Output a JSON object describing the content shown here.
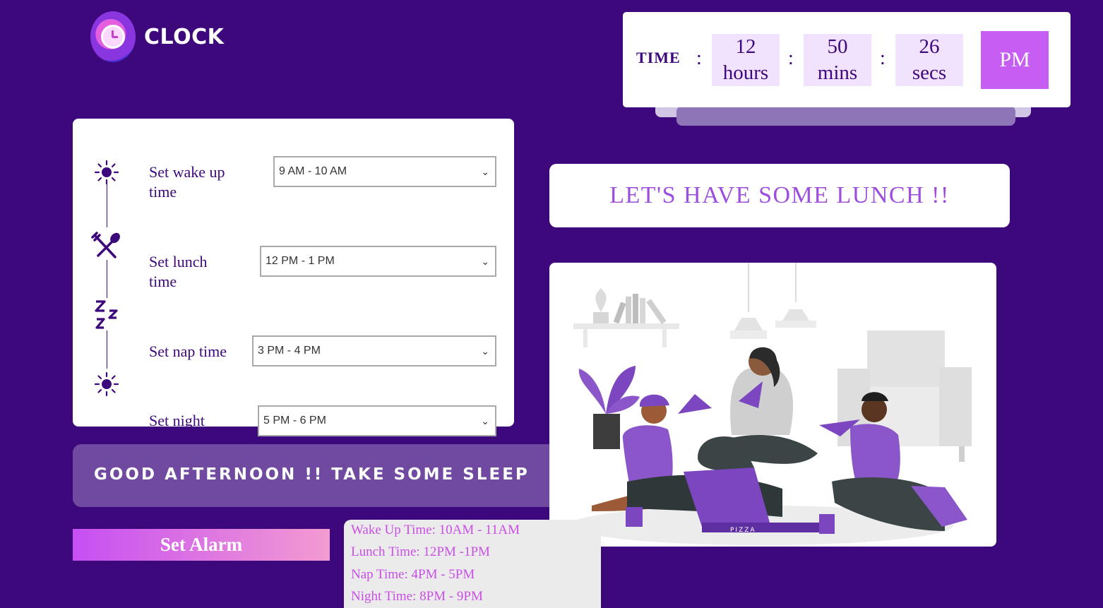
{
  "logo": {
    "text": "CLOCK",
    "icon": "clock-icon"
  },
  "time": {
    "label": "TIME",
    "hours_value": "12",
    "hours_unit": "hours",
    "mins_value": "50",
    "mins_unit": "mins",
    "secs_value": "26",
    "secs_unit": "secs",
    "separator": ":",
    "ampm": "PM"
  },
  "settings": {
    "rows": [
      {
        "icon": "sun-icon",
        "label_line1": "Set wake up",
        "label_line2": "time",
        "selected": "9 AM - 10 AM"
      },
      {
        "icon": "fork-spoon-icon",
        "label_line1": "Set lunch",
        "label_line2": "time",
        "selected": "12 PM - 1 PM"
      },
      {
        "icon": "sleep-zzz-icon",
        "label_line1": "Set nap time",
        "label_line2": "",
        "selected": "3 PM - 4 PM"
      },
      {
        "icon": "sun-icon",
        "label_line1": "Set night",
        "label_line2": "",
        "selected": "5 PM - 6 PM"
      }
    ]
  },
  "greeting": "GOOD AFTERNOON !! TAKE SOME SLEEP",
  "banner": "LET'S HAVE SOME LUNCH !!",
  "illustration": {
    "box_label": "PIZZA"
  },
  "alarm_button": "Set Alarm",
  "summary": [
    "Wake Up Time: 10AM - 11AM",
    "Lunch Time: 12PM -1PM",
    "Nap Time: 4PM - 5PM",
    "Night Time: 8PM - 9PM"
  ],
  "colors": {
    "background": "#3d087b",
    "accent": "#c65ef3",
    "text_dark": "#3d087b"
  }
}
